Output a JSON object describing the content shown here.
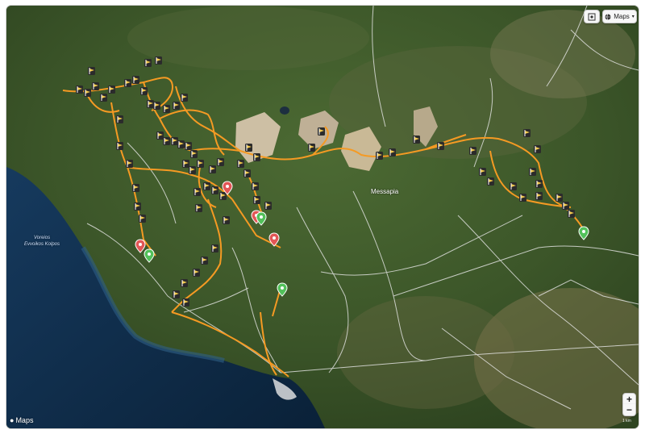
{
  "map": {
    "provider_label": "Maps",
    "type_button_label": "Maps",
    "zoom_in_label": "+",
    "zoom_out_label": "−",
    "sea_label_line1": "Voreios",
    "sea_label_line2": "Evvoikos Kolpos",
    "town_label": "Messapia",
    "scale_label": "1 km",
    "icons": {
      "locate": "locate-icon",
      "globe": "globe-icon",
      "apple": "apple-logo-icon",
      "flag": "flag-marker-icon",
      "pin": "pin-marker-icon"
    },
    "colors": {
      "track": "#f59a23",
      "road": "#e8e8e8",
      "sea_deep": "#0c2b46",
      "land": "#3f5b2b",
      "pin_red": "#e25656",
      "pin_green": "#52c15a",
      "flag": "#f2c84b"
    }
  }
}
